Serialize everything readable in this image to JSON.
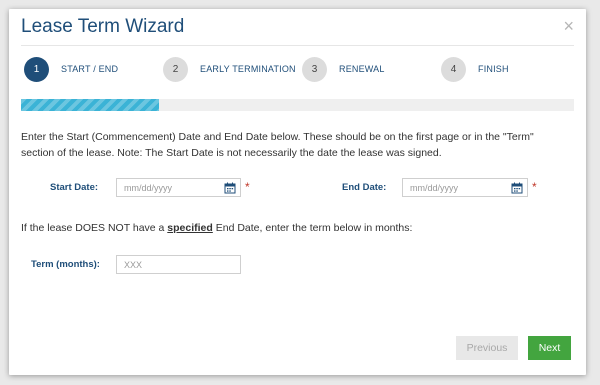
{
  "dialog": {
    "title": "Lease Term Wizard",
    "close_symbol": "×"
  },
  "steps": [
    {
      "number": "1",
      "label": "START / END",
      "active": true
    },
    {
      "number": "2",
      "label": "EARLY TERMINATION",
      "active": false
    },
    {
      "number": "3",
      "label": "RENEWAL",
      "active": false
    },
    {
      "number": "4",
      "label": "FINISH",
      "active": false
    }
  ],
  "progress": {
    "fraction": 0.25,
    "color": "#3bb3d6"
  },
  "description": "Enter the Start (Commencement) Date and End Date below. These should be on the first page or in the \"Term\" section of the lease. Note: The Start Date is not necessarily the date the lease was signed.",
  "form": {
    "start_date": {
      "label": "Start Date:",
      "placeholder": "mm/dd/yyyy",
      "required_mark": "*"
    },
    "end_date": {
      "label": "End Date:",
      "placeholder": "mm/dd/yyyy",
      "required_mark": "*"
    },
    "term_note": {
      "before": "If the lease DOES NOT have a ",
      "emphasis": "specified",
      "after": " End Date, enter the term below in months:"
    },
    "term_months": {
      "label": "Term (months):",
      "placeholder": "XXX"
    }
  },
  "buttons": {
    "previous": "Previous",
    "next": "Next"
  },
  "colors": {
    "primary": "#1f4e79",
    "next_button": "#43a53f",
    "required": "#c0392b"
  }
}
